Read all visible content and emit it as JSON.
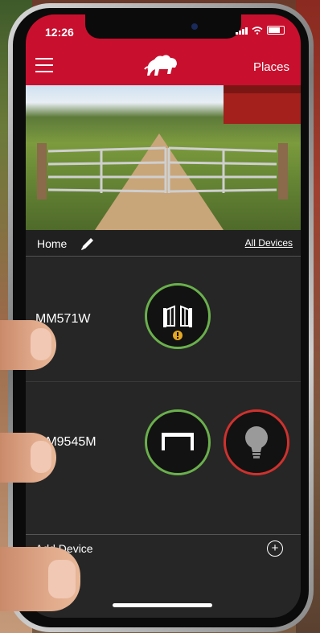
{
  "status_bar": {
    "time": "12:26"
  },
  "nav": {
    "places_label": "Places"
  },
  "location": {
    "name": "Home",
    "all_devices_label": "All Devices"
  },
  "devices": [
    {
      "name": "MM571W",
      "controls": [
        "gate-opener-icon"
      ],
      "status_ring": "#6ab04c"
    },
    {
      "name": "MM9545M",
      "controls": [
        "garage-door-icon",
        "light-bulb-icon"
      ],
      "status_rings": [
        "#6ab04c",
        "#d0312d"
      ]
    }
  ],
  "add_device": {
    "label": "Add Device"
  },
  "colors": {
    "brand": "#c8102e",
    "ok": "#6ab04c",
    "off": "#d0312d",
    "warning": "#e5a823"
  }
}
